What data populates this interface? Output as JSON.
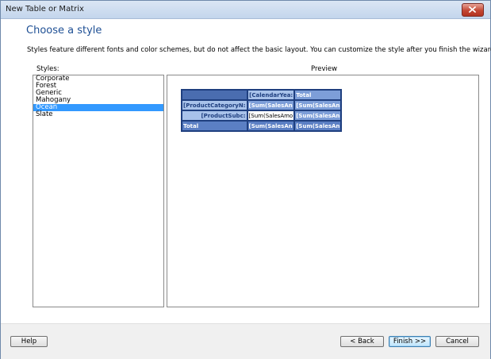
{
  "window": {
    "title": "New Table or Matrix"
  },
  "page": {
    "heading": "Choose a style",
    "description": "Styles feature different fonts and color schemes, but do not affect the basic layout. You can customize the style after you finish the wizard."
  },
  "styles": {
    "label": "Styles:",
    "items": [
      "Corporate",
      "Forest",
      "Generic",
      "Mahogany",
      "Ocean",
      "Slate"
    ],
    "selected": "Ocean"
  },
  "preview": {
    "label": "Preview",
    "cells": {
      "r1c2": "[CalendarYea:",
      "r1c3": "Total",
      "r2c1": "[ProductCategoryN:",
      "r2c2": "[Sum(SalesAn",
      "r2c3": "[Sum(SalesAn",
      "r3c1": "[ProductSubc:",
      "r3c2": "[Sum(SalesAmo",
      "r3c3": "[Sum(SalesAn",
      "r4c1": "Total",
      "r4c2": "[Sum(SalesAn",
      "r4c3": "[Sum(SalesAn"
    }
  },
  "buttons": {
    "help": "Help",
    "back": "< Back",
    "finish": "Finish >>",
    "cancel": "Cancel"
  },
  "colors": {
    "heading": "#1e4f94",
    "selection": "#3399ff",
    "ocean_dark": "#4a6db0",
    "ocean_mid": "#7d9ed8",
    "ocean_light": "#a8c2ea"
  }
}
